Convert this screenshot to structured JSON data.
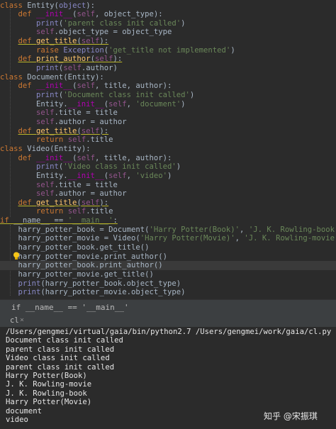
{
  "editor": {
    "lines": [
      [
        [
          "kw",
          "class "
        ],
        [
          "",
          "Entity("
        ],
        [
          "bi",
          "object"
        ],
        [
          "",
          "):"
        ]
      ],
      [
        [
          "",
          "    "
        ],
        [
          "kw",
          "def "
        ],
        [
          "dunder",
          "__init__"
        ],
        [
          "",
          "("
        ],
        [
          "self",
          "self"
        ],
        [
          "",
          ", object_type):"
        ]
      ],
      [
        [
          "",
          "        "
        ],
        [
          "bi",
          "print"
        ],
        [
          "",
          "("
        ],
        [
          "str",
          "'parent class init called'"
        ],
        [
          "",
          ")"
        ]
      ],
      [
        [
          "",
          "        "
        ],
        [
          "self",
          "self"
        ],
        [
          "",
          ".object_type = object_type"
        ]
      ],
      [
        [
          "",
          "    "
        ],
        [
          "kw ul",
          "def "
        ],
        [
          "fn ul",
          "get_title"
        ],
        [
          "ul",
          "("
        ],
        [
          "self ul",
          "self"
        ],
        [
          "ul",
          "):"
        ]
      ],
      [
        [
          "",
          "        "
        ],
        [
          "kw",
          "raise "
        ],
        [
          "bi",
          "Exception"
        ],
        [
          "",
          "("
        ],
        [
          "str",
          "'get_title not implemented'"
        ],
        [
          "",
          ")"
        ]
      ],
      [
        [
          "",
          "    "
        ],
        [
          "kw ul",
          "def "
        ],
        [
          "fn ul",
          "print_author"
        ],
        [
          "ul",
          "("
        ],
        [
          "self ul",
          "self"
        ],
        [
          "ul",
          "):"
        ]
      ],
      [
        [
          "",
          "        "
        ],
        [
          "bi",
          "print"
        ],
        [
          "",
          "("
        ],
        [
          "self",
          "self"
        ],
        [
          "",
          ".author)"
        ]
      ],
      [
        [
          "kw",
          "class "
        ],
        [
          "",
          "Document(Entity):"
        ]
      ],
      [
        [
          "",
          "    "
        ],
        [
          "kw",
          "def "
        ],
        [
          "dunder",
          "__init__"
        ],
        [
          "",
          "("
        ],
        [
          "self",
          "self"
        ],
        [
          "",
          ", title, author):"
        ]
      ],
      [
        [
          "",
          "        "
        ],
        [
          "bi",
          "print"
        ],
        [
          "",
          "("
        ],
        [
          "str",
          "'Document class init called'"
        ],
        [
          "",
          ")"
        ]
      ],
      [
        [
          "",
          "        Entity."
        ],
        [
          "dunder",
          "__init__"
        ],
        [
          "",
          "("
        ],
        [
          "self",
          "self"
        ],
        [
          "",
          ", "
        ],
        [
          "str",
          "'document'"
        ],
        [
          "",
          ")"
        ]
      ],
      [
        [
          "",
          "        "
        ],
        [
          "self",
          "self"
        ],
        [
          "",
          ".title = title"
        ]
      ],
      [
        [
          "",
          "        "
        ],
        [
          "self",
          "self"
        ],
        [
          "",
          ".author = author"
        ]
      ],
      [
        [
          "",
          "    "
        ],
        [
          "kw ul",
          "def "
        ],
        [
          "fn ul",
          "get_title"
        ],
        [
          "ul",
          "("
        ],
        [
          "self ul",
          "self"
        ],
        [
          "ul",
          "):"
        ]
      ],
      [
        [
          "",
          "        "
        ],
        [
          "kw",
          "return "
        ],
        [
          "self",
          "self"
        ],
        [
          "",
          ".title"
        ]
      ],
      [
        [
          "kw",
          "class "
        ],
        [
          "",
          "Video(Entity):"
        ]
      ],
      [
        [
          "",
          "    "
        ],
        [
          "kw",
          "def "
        ],
        [
          "dunder",
          "__init__"
        ],
        [
          "",
          "("
        ],
        [
          "self",
          "self"
        ],
        [
          "",
          ", title, author):"
        ]
      ],
      [
        [
          "",
          "        "
        ],
        [
          "bi",
          "print"
        ],
        [
          "",
          "("
        ],
        [
          "str",
          "'Video class init called'"
        ],
        [
          "",
          ")"
        ]
      ],
      [
        [
          "",
          "        Entity."
        ],
        [
          "dunder",
          "__init__"
        ],
        [
          "",
          "("
        ],
        [
          "self",
          "self"
        ],
        [
          "",
          ", "
        ],
        [
          "str",
          "'video'"
        ],
        [
          "",
          ")"
        ]
      ],
      [
        [
          "",
          "        "
        ],
        [
          "self",
          "self"
        ],
        [
          "",
          ".title = title"
        ]
      ],
      [
        [
          "",
          "        "
        ],
        [
          "self",
          "self"
        ],
        [
          "",
          ".author = author"
        ]
      ],
      [
        [
          "",
          "    "
        ],
        [
          "kw ul",
          "def "
        ],
        [
          "fn ul",
          "get_title"
        ],
        [
          "ul",
          "("
        ],
        [
          "self ul",
          "self"
        ],
        [
          "ul",
          "):"
        ]
      ],
      [
        [
          "",
          "        "
        ],
        [
          "kw",
          "return "
        ],
        [
          "self",
          "self"
        ],
        [
          "",
          ".title"
        ]
      ],
      [
        [
          "kw ul",
          "if "
        ],
        [
          "ul",
          "__name__ == "
        ],
        [
          "str ul",
          "'__main__'"
        ],
        [
          "ul",
          ":"
        ]
      ],
      [
        [
          "",
          "    harry_potter_book = Document("
        ],
        [
          "str",
          "'Harry Potter(Book)'"
        ],
        [
          "",
          ", "
        ],
        [
          "str",
          "'J. K. Rowling-book'"
        ],
        [
          "",
          ")"
        ]
      ],
      [
        [
          "",
          "    harry_potter_movie = Video("
        ],
        [
          "str",
          "'Harry Potter(Movie)'"
        ],
        [
          "",
          ", "
        ],
        [
          "str",
          "'J. K. Rowling-movie'"
        ],
        [
          "",
          ")"
        ]
      ],
      [
        [
          "",
          "    harry_potter_book.get_title()"
        ]
      ],
      [
        [
          "",
          "    harry_potter_movie.print_author()"
        ]
      ],
      [
        [
          "",
          "    harry_potter_book.print_author()"
        ]
      ],
      [
        [
          "",
          "    harry_potter_movie.get_title()"
        ]
      ],
      [
        [
          "",
          "    "
        ],
        [
          "bi",
          "print"
        ],
        [
          "",
          "(harry_potter_book.object_type)"
        ]
      ],
      [
        [
          "",
          "    "
        ],
        [
          "bi",
          "print"
        ],
        [
          "",
          "(harry_potter_movie.object_type)"
        ]
      ]
    ]
  },
  "breadcrumb": {
    "text": "if __name__ == '__main__'"
  },
  "console": {
    "tab_label": "cl",
    "tab_close": "×",
    "lines": [
      "/Users/gengmei/virtual/gaia/bin/python2.7 /Users/gengmei/work/gaia/cl.py",
      "Document class init called",
      "parent class init called",
      "Video class init called",
      "parent class init called",
      "Harry Potter(Book)",
      "J. K. Rowling-movie",
      "J. K. Rowling-book",
      "Harry Potter(Movie)",
      "document",
      "video"
    ]
  },
  "watermark": {
    "text": "知乎 @宋振琪"
  },
  "colors": {
    "background": "#2b2b2b",
    "keyword": "#cc7832",
    "string": "#6a8759",
    "self": "#94558d",
    "function": "#ffc66d",
    "dunder": "#b200b2",
    "bulb": "#f5c518"
  },
  "icons": {
    "intention": "lightbulb-icon"
  }
}
